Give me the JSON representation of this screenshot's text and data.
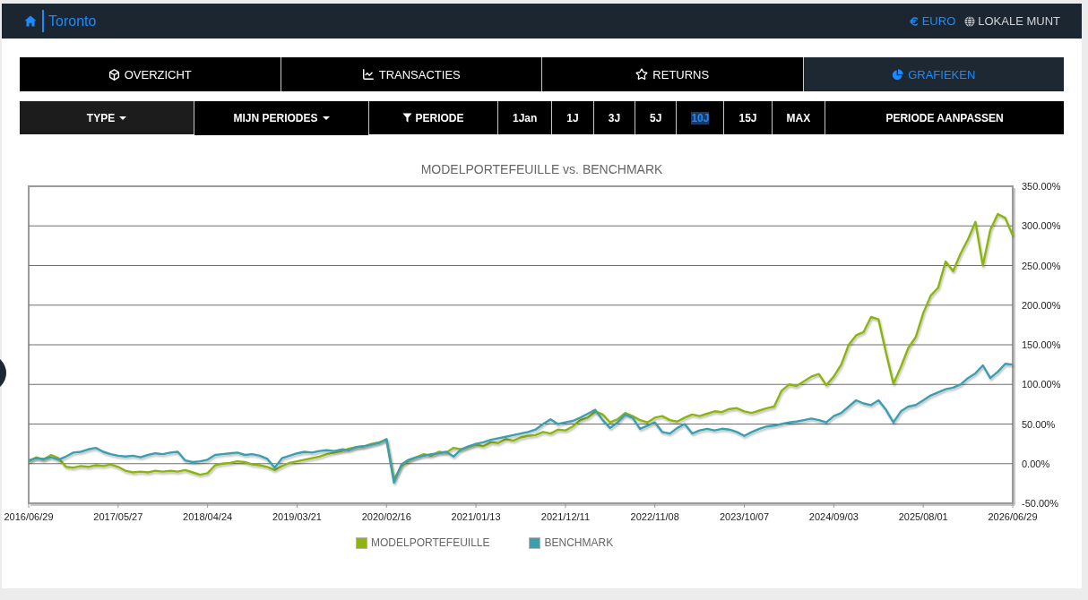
{
  "header": {
    "title": "Toronto",
    "currencies": [
      {
        "label": "EURO",
        "selected": true
      },
      {
        "label": "LOKALE MUNT",
        "selected": false
      }
    ]
  },
  "tabs": [
    {
      "label": "OVERZICHT",
      "selected": false
    },
    {
      "label": "TRANSACTIES",
      "selected": false
    },
    {
      "label": "RETURNS",
      "selected": false
    },
    {
      "label": "GRAFIEKEN",
      "selected": true
    }
  ],
  "period_bar": {
    "menus": [
      {
        "label": "TYPE",
        "active": false
      },
      {
        "label": "MIJN PERIODES",
        "active": true
      }
    ],
    "filter_label": "PERIODE",
    "periods": [
      {
        "label": "1Jan",
        "selected": false
      },
      {
        "label": "1J",
        "selected": false
      },
      {
        "label": "3J",
        "selected": false
      },
      {
        "label": "5J",
        "selected": false
      },
      {
        "label": "10J",
        "selected": true
      },
      {
        "label": "15J",
        "selected": false
      },
      {
        "label": "MAX",
        "selected": false
      }
    ],
    "adjust_button": "PERIODE AANPASSEN"
  },
  "chart": {
    "chart_data": {
      "type": "line",
      "title": "MODELPORTEFEUILLE vs. BENCHMARK",
      "grid": true,
      "categories": [
        "2016/06/29",
        null,
        null,
        null,
        null,
        null,
        null,
        null,
        null,
        null,
        null,
        null,
        "2017/05/27",
        null,
        null,
        null,
        null,
        null,
        null,
        null,
        null,
        null,
        null,
        null,
        "2018/04/24",
        null,
        null,
        null,
        null,
        null,
        null,
        null,
        null,
        null,
        null,
        null,
        "2019/03/21",
        null,
        null,
        null,
        null,
        null,
        null,
        null,
        null,
        null,
        null,
        null,
        "2020/02/16",
        null,
        null,
        null,
        null,
        null,
        null,
        null,
        null,
        null,
        null,
        null,
        "2021/01/13",
        null,
        null,
        null,
        null,
        null,
        null,
        null,
        null,
        null,
        null,
        null,
        "2021/12/11",
        null,
        null,
        null,
        null,
        null,
        null,
        null,
        null,
        null,
        null,
        null,
        "2022/11/08",
        null,
        null,
        null,
        null,
        null,
        null,
        null,
        null,
        null,
        null,
        null,
        "2023/10/07",
        null,
        null,
        null,
        null,
        null,
        null,
        null,
        null,
        null,
        null,
        null,
        "2024/09/03",
        null,
        null,
        null,
        null,
        null,
        null,
        null,
        null,
        null,
        null,
        null,
        "2025/08/01",
        null,
        null,
        null,
        null,
        null,
        null,
        null,
        null,
        null,
        null,
        null,
        "2026/06/29"
      ],
      "ylim": [
        -50,
        350
      ],
      "yticks": [
        {
          "value": 350,
          "label": "350.00%"
        },
        {
          "value": 300,
          "label": "300.00%"
        },
        {
          "value": 250,
          "label": "250.00%"
        },
        {
          "value": 200,
          "label": "200.00%"
        },
        {
          "value": 150,
          "label": "150.00%"
        },
        {
          "value": 100,
          "label": "100.00%"
        },
        {
          "value": 50,
          "label": "50.00%"
        },
        {
          "value": 0,
          "label": "0.00%"
        },
        {
          "value": -50,
          "label": "-50.00%"
        }
      ],
      "series": [
        {
          "name": "MODELPORTEFEUILLE",
          "color": "#8db40f",
          "values": [
            3,
            8,
            5,
            11,
            7,
            -4,
            -5,
            -3,
            -4,
            -2,
            -3,
            -1,
            -4,
            -9,
            -11,
            -10,
            -11,
            -9,
            -10,
            -9,
            -10,
            -8,
            -11,
            -14,
            -12,
            -2,
            0,
            1,
            3,
            2,
            -1,
            -2,
            -4,
            -8,
            -3,
            1,
            3,
            5,
            7,
            9,
            12,
            14,
            16,
            19,
            21,
            22,
            25,
            27,
            30,
            -20,
            -3,
            4,
            8,
            12,
            10,
            15,
            14,
            20,
            18,
            21,
            24,
            22,
            27,
            26,
            31,
            29,
            33,
            35,
            36,
            40,
            38,
            43,
            42,
            47,
            55,
            58,
            66,
            62,
            52,
            56,
            64,
            60,
            55,
            52,
            58,
            60,
            55,
            53,
            58,
            62,
            60,
            63,
            66,
            65,
            69,
            70,
            66,
            64,
            67,
            70,
            72,
            92,
            100,
            98,
            104,
            110,
            113,
            99,
            110,
            125,
            150,
            162,
            166,
            185,
            182,
            140,
            101,
            122,
            146,
            160,
            190,
            212,
            222,
            255,
            243,
            265,
            283,
            305,
            250,
            295,
            315,
            310,
            288
          ]
        },
        {
          "name": "BENCHMARK",
          "color": "#3a9fb0",
          "values": [
            4,
            7,
            6,
            8,
            5,
            9,
            14,
            15,
            18,
            20,
            15,
            12,
            10,
            9,
            10,
            8,
            11,
            13,
            12,
            14,
            15,
            4,
            2,
            3,
            5,
            11,
            12,
            13,
            14,
            11,
            12,
            10,
            6,
            -5,
            7,
            10,
            13,
            15,
            14,
            16,
            17,
            16,
            18,
            17,
            21,
            22,
            24,
            26,
            31,
            -24,
            -1,
            5,
            8,
            10,
            12,
            13,
            15,
            9,
            18,
            22,
            25,
            27,
            30,
            32,
            34,
            36,
            38,
            40,
            43,
            50,
            56,
            50,
            52,
            54,
            58,
            63,
            68,
            55,
            45,
            52,
            62,
            58,
            44,
            48,
            52,
            40,
            38,
            45,
            50,
            38,
            42,
            44,
            42,
            44,
            43,
            40,
            35,
            40,
            44,
            47,
            48,
            50,
            52,
            53,
            55,
            57,
            55,
            52,
            60,
            64,
            72,
            80,
            76,
            74,
            80,
            68,
            52,
            66,
            72,
            74,
            80,
            86,
            90,
            94,
            96,
            100,
            108,
            114,
            124,
            108,
            116,
            126,
            125
          ]
        }
      ]
    }
  }
}
